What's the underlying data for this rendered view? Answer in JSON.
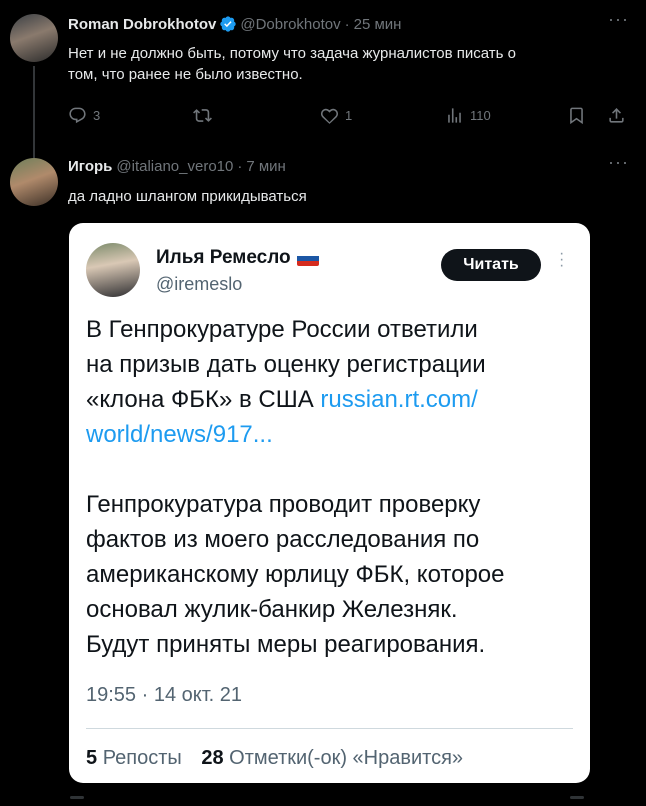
{
  "tweet1": {
    "name": "Roman Dobrokhotov",
    "handle": "@Dobrokhotov",
    "separator": "·",
    "time": "25 мин",
    "line1": "Нет и не должно быть, потому что задача журналистов писать о",
    "line2": "том, что ранее не было известно.",
    "replies": "3",
    "retweets": "",
    "likes": "1",
    "views": "110"
  },
  "tweet2": {
    "name": "Игорь",
    "handle": "@italiano_vero10",
    "separator": "·",
    "time": "7 мин",
    "text": "да ладно шлангом прикидываться"
  },
  "quoted": {
    "name": "Илья Ремесло",
    "handle": "@iremeslo",
    "read_button": "Читать",
    "para1_lines": [
      "В Генпрокуратуре России ответили",
      "на призыв дать оценку регистрации",
      "«клона ФБК» в США "
    ],
    "link_part1": "russian.rt.com/",
    "link_part2": "world/news/917...",
    "para2_lines": [
      "Генпрокуратура проводит проверку",
      "фактов из моего расследования по",
      "американскому юрлицу ФБК, которое",
      "основал жулик-банкир Железняк.",
      "Будут приняты меры реагирования."
    ],
    "date": "19:55 · 14 окт. 21",
    "reposts_count": "5",
    "reposts_label": "Репосты",
    "likes_count": "28",
    "likes_label": "Отметки(-ок) «Нравится»"
  },
  "colors": {
    "background": "#000000",
    "text": "#e7e9ea",
    "secondary": "#71767b",
    "link": "#1d9bf0",
    "verified": "#1d9bf0"
  },
  "icons": [
    "verified-badge-icon",
    "reply-icon",
    "retweet-icon",
    "like-icon",
    "views-icon",
    "bookmark-icon",
    "share-icon",
    "more-icon",
    "russia-flag-icon"
  ]
}
